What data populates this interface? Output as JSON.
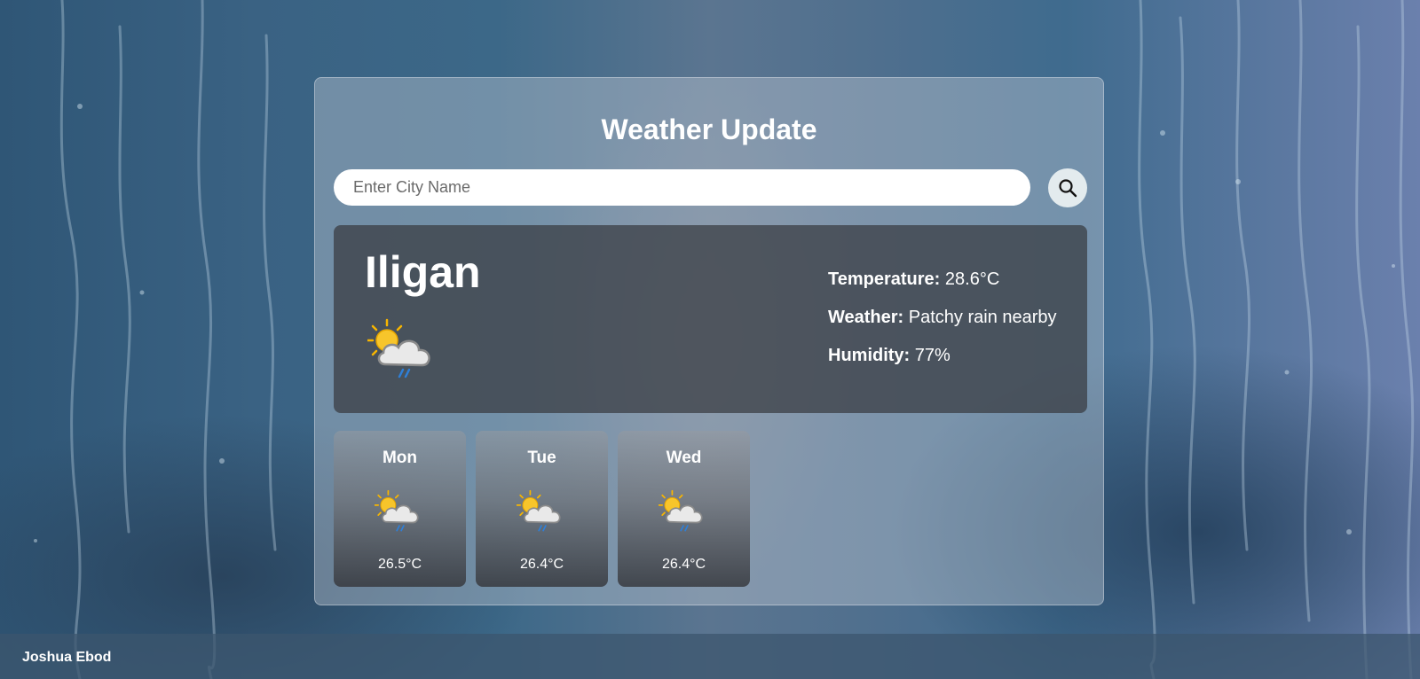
{
  "header": {
    "title": "Weather Update"
  },
  "search": {
    "placeholder": "Enter City Name",
    "value": "",
    "button_icon": "search-icon"
  },
  "current": {
    "city": "Iligan",
    "icon": "partly-cloudy-rain-icon",
    "temperature_label": "Temperature:",
    "temperature_value": "28.6°C",
    "weather_label": "Weather:",
    "weather_value": "Patchy rain nearby",
    "humidity_label": "Humidity:",
    "humidity_value": "77%"
  },
  "forecast": [
    {
      "day": "Mon",
      "icon": "partly-cloudy-rain-icon",
      "temp": "26.5°C"
    },
    {
      "day": "Tue",
      "icon": "partly-cloudy-rain-icon",
      "temp": "26.4°C"
    },
    {
      "day": "Wed",
      "icon": "partly-cloudy-rain-icon",
      "temp": "26.4°C"
    }
  ],
  "footer": {
    "author": "Joshua Ebod"
  },
  "colors": {
    "accent_sun": "#f7c52b",
    "rain": "#2f7fd6",
    "text": "#ffffff"
  }
}
